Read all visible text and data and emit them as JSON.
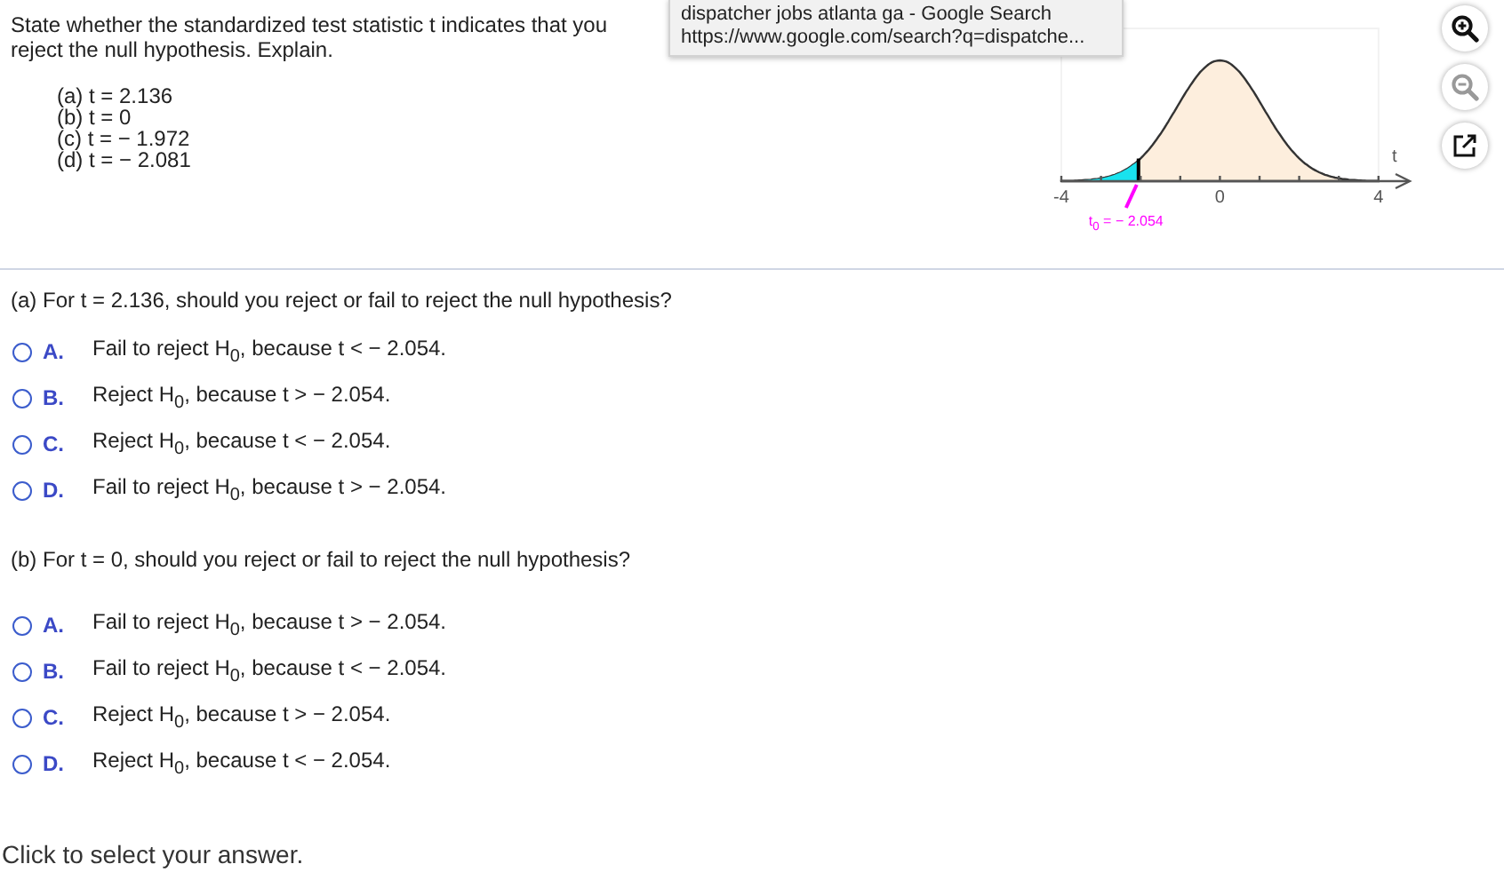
{
  "question": {
    "lines": [
      "State whether the standardized test statistic t indicates that you",
      "reject the null hypothesis. Explain."
    ],
    "parts": [
      "(a) t = 2.136",
      "(b) t = 0",
      "(c) t = − 1.972",
      "(d) t = − 2.081"
    ]
  },
  "tooltip": {
    "title": "dispatcher jobs atlanta ga - Google Search",
    "url": "https://www.google.com/search?q=dispatche..."
  },
  "graph": {
    "axis_label": "t",
    "tick_labels": [
      "-4",
      "0",
      "4"
    ],
    "critical_label": "t$_{0}$ = − 2.054"
  },
  "tools": [
    {
      "kind": "zoom-in",
      "disabled": false
    },
    {
      "kind": "zoom-out",
      "disabled": true
    },
    {
      "kind": "popout",
      "disabled": false
    }
  ],
  "sections": [
    {
      "prompt": "(a) For t = 2.136, should you reject or fail to reject the null hypothesis?",
      "options": [
        {
          "letter": "A.",
          "text": "Fail to reject H$_{0}$, because t < − 2.054.",
          "selected": false
        },
        {
          "letter": "B.",
          "text": "Reject H$_{0}$, because t > − 2.054.",
          "selected": false
        },
        {
          "letter": "C.",
          "text": "Reject H$_{0}$, because t < − 2.054.",
          "selected": false
        },
        {
          "letter": "D.",
          "text": "Fail to reject H$_{0}$, because t > − 2.054.",
          "selected": false
        }
      ]
    },
    {
      "prompt": "(b) For t = 0, should you reject or fail to reject the null hypothesis?",
      "options": [
        {
          "letter": "A.",
          "text": "Fail to reject H$_{0}$, because t > − 2.054.",
          "selected": false
        },
        {
          "letter": "B.",
          "text": "Fail to reject H$_{0}$, because t < − 2.054.",
          "selected": false
        },
        {
          "letter": "C.",
          "text": "Reject H$_{0}$, because t > − 2.054.",
          "selected": false
        },
        {
          "letter": "D.",
          "text": "Reject H$_{0}$, because t < − 2.054.",
          "selected": false
        }
      ]
    }
  ],
  "footer": "Click to select your answer."
}
